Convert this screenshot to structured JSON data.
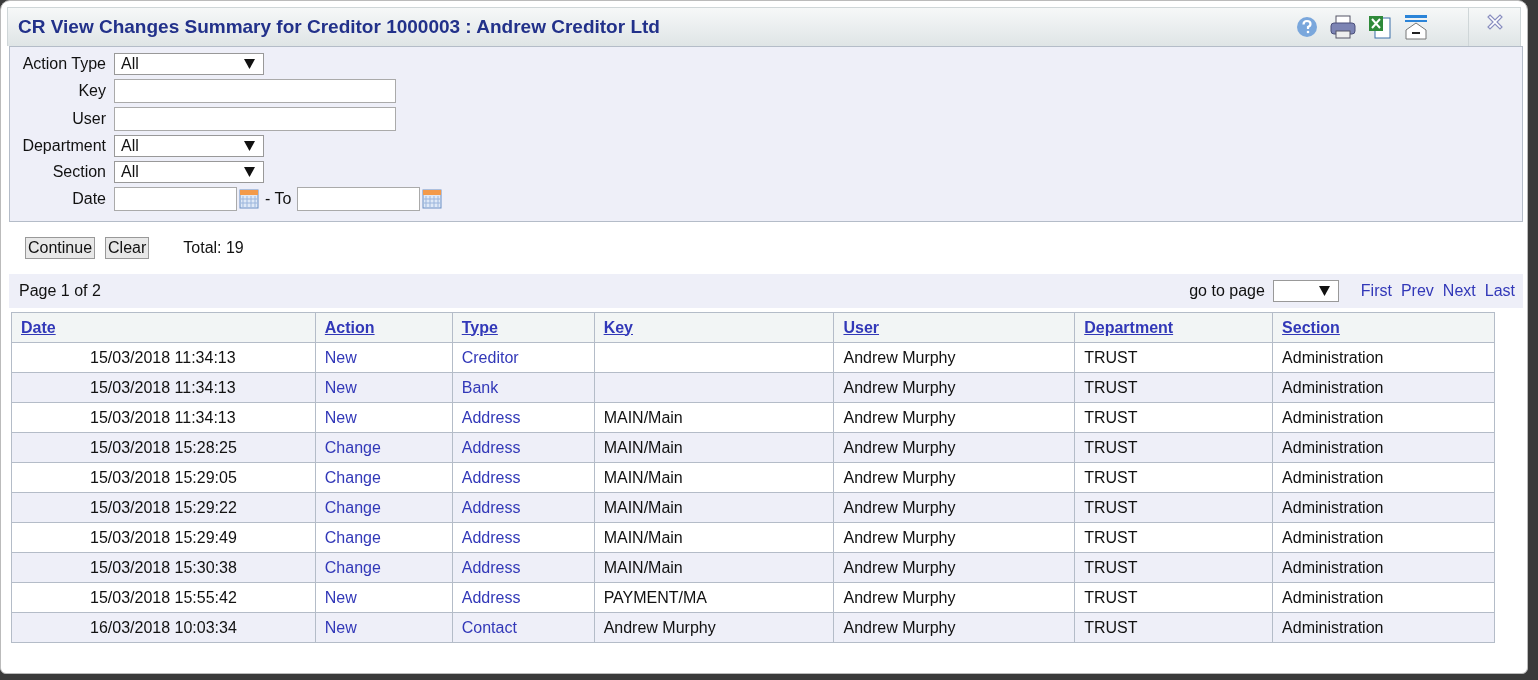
{
  "window": {
    "title": "CR View Changes Summary for Creditor 1000003 : Andrew Creditor Ltd"
  },
  "filters": [
    {
      "kind": "select",
      "label": "Action Type",
      "value": "All"
    },
    {
      "kind": "text",
      "label": "Key"
    },
    {
      "kind": "text",
      "label": "User"
    },
    {
      "kind": "select",
      "label": "Department",
      "value": "All"
    },
    {
      "kind": "select",
      "label": "Section",
      "value": "All"
    },
    {
      "kind": "daterange",
      "label": "Date",
      "separator": "- To"
    }
  ],
  "buttons": [
    "Continue",
    "Clear"
  ],
  "total": "Total: 19",
  "pager": {
    "page_label": "Page 1 of 2",
    "goto_label": "go to page",
    "links": [
      "First",
      "Prev",
      "Next",
      "Last"
    ]
  },
  "table": {
    "columns": [
      "Date",
      "Action",
      "Type",
      "Key",
      "User",
      "Department",
      "Section"
    ],
    "rows": [
      [
        "15/03/2018 11:34:13",
        "New",
        "Creditor",
        "",
        "Andrew Murphy",
        "TRUST",
        "Administration"
      ],
      [
        "15/03/2018 11:34:13",
        "New",
        "Bank",
        "",
        "Andrew Murphy",
        "TRUST",
        "Administration"
      ],
      [
        "15/03/2018 11:34:13",
        "New",
        "Address",
        "MAIN/Main",
        "Andrew Murphy",
        "TRUST",
        "Administration"
      ],
      [
        "15/03/2018 15:28:25",
        "Change",
        "Address",
        "MAIN/Main",
        "Andrew Murphy",
        "TRUST",
        "Administration"
      ],
      [
        "15/03/2018 15:29:05",
        "Change",
        "Address",
        "MAIN/Main",
        "Andrew Murphy",
        "TRUST",
        "Administration"
      ],
      [
        "15/03/2018 15:29:22",
        "Change",
        "Address",
        "MAIN/Main",
        "Andrew Murphy",
        "TRUST",
        "Administration"
      ],
      [
        "15/03/2018 15:29:49",
        "Change",
        "Address",
        "MAIN/Main",
        "Andrew Murphy",
        "TRUST",
        "Administration"
      ],
      [
        "15/03/2018 15:30:38",
        "Change",
        "Address",
        "MAIN/Main",
        "Andrew Murphy",
        "TRUST",
        "Administration"
      ],
      [
        "15/03/2018 15:55:42",
        "New",
        "Address",
        "PAYMENT/MA",
        "Andrew Murphy",
        "TRUST",
        "Administration"
      ],
      [
        "16/03/2018 10:03:34",
        "New",
        "Contact",
        "Andrew Murphy",
        "Andrew Murphy",
        "TRUST",
        "Administration"
      ]
    ]
  }
}
